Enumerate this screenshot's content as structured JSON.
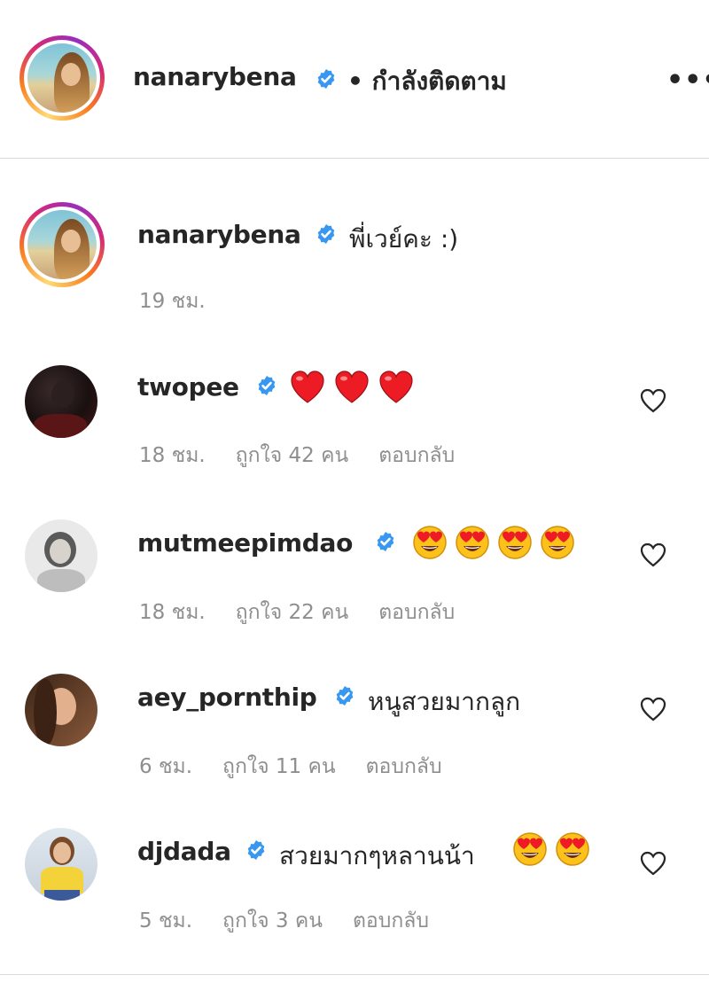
{
  "post_header": {
    "username": "nanarybena",
    "follow_status": "• กำลังติดตาม",
    "more_label": "•••"
  },
  "caption": {
    "username": "nanarybena",
    "text": "พี่เวย์คะ :)",
    "time": "19 ชม."
  },
  "comments": [
    {
      "username": "twopee",
      "text": "",
      "emoji": [
        "red-heart",
        "red-heart",
        "red-heart"
      ],
      "time": "18 ชม.",
      "likes": "ถูกใจ 42 คน",
      "reply": "ตอบกลับ"
    },
    {
      "username": "mutmeepimdao",
      "text": "",
      "emoji": [
        "heart-eyes",
        "heart-eyes",
        "heart-eyes",
        "heart-eyes"
      ],
      "time": "18 ชม.",
      "likes": "ถูกใจ 22 คน",
      "reply": "ตอบกลับ"
    },
    {
      "username": "aey_pornthip",
      "text": "หนูสวยมากลูก",
      "emoji": [],
      "time": "6 ชม.",
      "likes": "ถูกใจ 11 คน",
      "reply": "ตอบกลับ"
    },
    {
      "username": "djdada",
      "text": "สวยมากๆหลานน้า",
      "emoji": [
        "heart-eyes",
        "heart-eyes"
      ],
      "time": "5 ชม.",
      "likes": "ถูกใจ 3 คน",
      "reply": "ตอบกลับ"
    }
  ],
  "colors": {
    "verified": "#3897f0",
    "heart_red": "#ed1c24",
    "meta_gray": "#8e8e8e"
  }
}
